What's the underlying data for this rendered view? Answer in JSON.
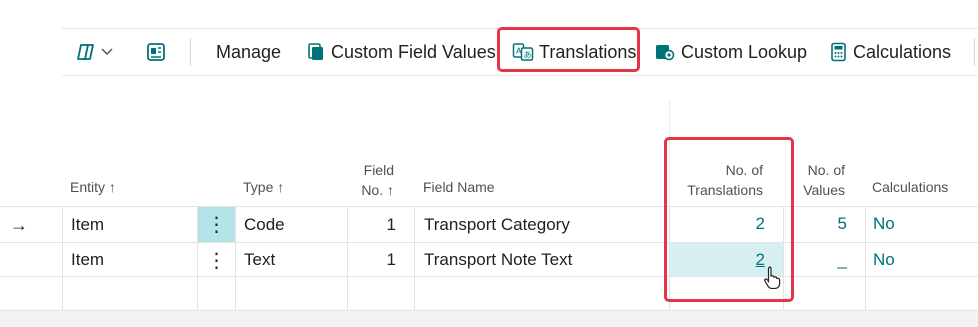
{
  "toolbar": {
    "manage_label": "Manage",
    "custom_field_values_label": "Custom Field Values",
    "translations_label": "Translations",
    "custom_lookup_label": "Custom Lookup",
    "calculations_label": "Calculations"
  },
  "table": {
    "columns": {
      "entity": "Entity ↑",
      "type": "Type ↑",
      "field_no_line1": "Field",
      "field_no_line2": "No. ↑",
      "field_name": "Field Name",
      "translations_line1": "No. of",
      "translations_line2": "Translations",
      "values_line1": "No. of",
      "values_line2": "Values",
      "calculations": "Calculations"
    },
    "rows": [
      {
        "arrow": "→",
        "entity": "Item",
        "menu": "⋮",
        "type": "Code",
        "field_no": "1",
        "field_name": "Transport Category",
        "translations": "2",
        "values": "5",
        "calculations": "No"
      },
      {
        "arrow": "",
        "entity": "Item",
        "menu": "⋮",
        "type": "Text",
        "field_no": "1",
        "field_name": "Transport Note Text",
        "translations": "2",
        "values": "_",
        "calculations": "No"
      }
    ]
  },
  "colors": {
    "accent": "#00727a",
    "highlight": "#e5344a",
    "selected_cell": "#d6eff1",
    "menu_cell": "#b4e4e8"
  }
}
